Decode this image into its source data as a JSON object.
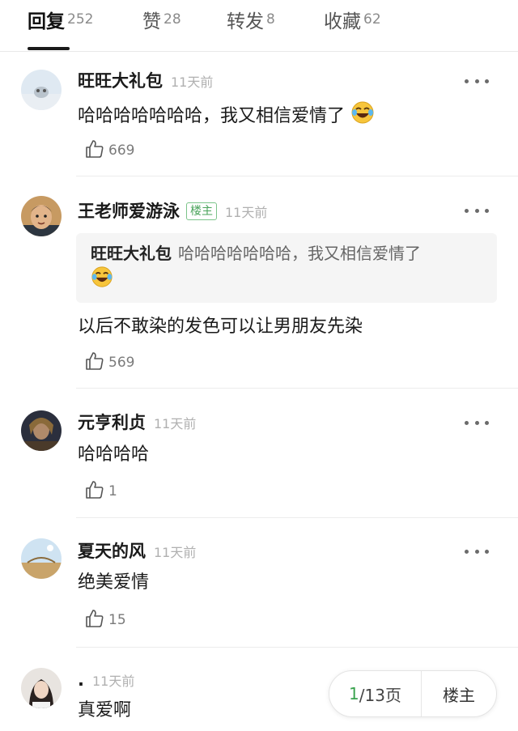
{
  "tabs": [
    {
      "label": "回复",
      "count": "252"
    },
    {
      "label": "赞",
      "count": "28"
    },
    {
      "label": "转发",
      "count": "8"
    },
    {
      "label": "收藏",
      "count": "62"
    }
  ],
  "comments": [
    {
      "user": "旺旺大礼包",
      "time": "11天前",
      "text": "哈哈哈哈哈哈哈，我又相信爱情了",
      "likes": "669"
    },
    {
      "user": "王老师爱游泳",
      "badge": "楼主",
      "time": "11天前",
      "quote": {
        "user": "旺旺大礼包",
        "text": "哈哈哈哈哈哈哈，我又相信爱情了"
      },
      "text": "以后不敢染的发色可以让男朋友先染",
      "likes": "569"
    },
    {
      "user": "元亨利贞",
      "time": "11天前",
      "text": "哈哈哈哈",
      "likes": "1"
    },
    {
      "user": "夏天的风",
      "time": "11天前",
      "text": "绝美爱情",
      "likes": "15"
    },
    {
      "user": ".",
      "time": "11天前",
      "text": "真爱啊"
    }
  ],
  "pager": {
    "current": "1",
    "total_text": "/13页",
    "op_label": "楼主"
  },
  "colors": {
    "accent_green": "#3aa34f",
    "badge_green": "#4aa35b"
  }
}
